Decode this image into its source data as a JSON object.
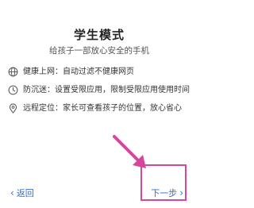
{
  "header": {
    "title": "学生模式",
    "subtitle": "给孩子一部放心安全的手机"
  },
  "features": [
    {
      "icon": "globe-icon",
      "text": "健康上网：自动过滤不健康网页"
    },
    {
      "icon": "clock-icon",
      "text": "防沉迷：设置受限应用，限制受限应用使用时间"
    },
    {
      "icon": "location-pin-icon",
      "text": "远程定位：家长可查看孩子的位置，放心省心"
    }
  ],
  "footer": {
    "back_label": "返回",
    "next_label": "下一步"
  },
  "colors": {
    "accent": "#2f6fd6",
    "annotation": "#d6469a"
  }
}
